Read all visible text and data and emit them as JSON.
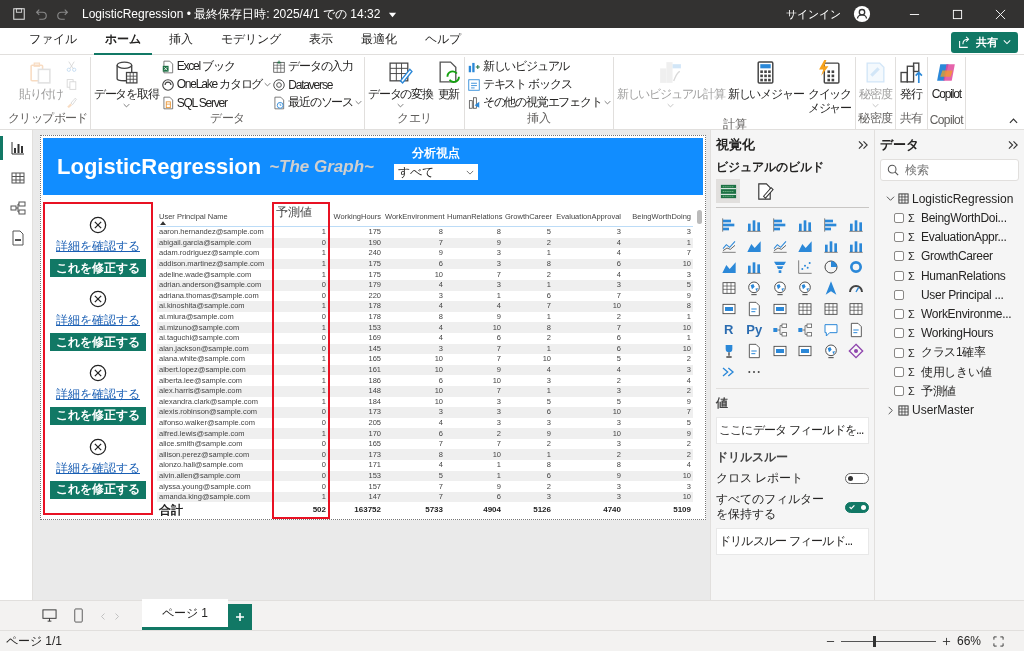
{
  "window": {
    "title": "LogisticRegression • 最終保存日時: 2025/4/1 での 14:32",
    "sign_in": "サインイン"
  },
  "menu_tabs": [
    {
      "label": "ファイル",
      "selected": false
    },
    {
      "label": "ホーム",
      "selected": true
    },
    {
      "label": "挿入",
      "selected": false
    },
    {
      "label": "モデリング",
      "selected": false
    },
    {
      "label": "表示",
      "selected": false
    },
    {
      "label": "最適化",
      "selected": false
    },
    {
      "label": "ヘルプ",
      "selected": false
    }
  ],
  "share_button": "共有",
  "ribbon": [
    {
      "label": "クリップボード",
      "columns": [
        [
          {
            "kind": "large",
            "label": "貼り付け",
            "disabled": true,
            "has_menu": false
          }
        ],
        [
          {
            "kind": "icon",
            "disabled": true
          },
          {
            "kind": "icon",
            "disabled": true
          },
          {
            "kind": "icon",
            "disabled": true
          }
        ]
      ]
    },
    {
      "label": "データ",
      "columns": [
        [
          {
            "kind": "large",
            "label": "データを取得",
            "disabled": false,
            "has_menu": true
          }
        ],
        [
          {
            "kind": "small",
            "label": "Excel ブック",
            "disabled": false,
            "has_menu": false
          },
          {
            "kind": "small",
            "label": "OneLake カタログ",
            "disabled": false,
            "has_menu": true
          },
          {
            "kind": "small",
            "label": "SQL Server",
            "disabled": false,
            "has_menu": false
          }
        ],
        [
          {
            "kind": "small",
            "label": "データの入力",
            "disabled": false,
            "has_menu": false
          },
          {
            "kind": "small",
            "label": "Dataverse",
            "disabled": false,
            "has_menu": false
          },
          {
            "kind": "small",
            "label": "最近のソース",
            "disabled": false,
            "has_menu": true
          }
        ]
      ]
    },
    {
      "label": "クエリ",
      "columns": [
        [
          {
            "kind": "large",
            "label": "データの変換",
            "disabled": false,
            "has_menu": true
          }
        ],
        [
          {
            "kind": "large",
            "label": "更新",
            "disabled": false,
            "has_menu": false
          }
        ]
      ]
    },
    {
      "label": "挿入",
      "columns": [
        [
          {
            "kind": "small",
            "label": "新しいビジュアル",
            "disabled": false,
            "has_menu": false
          },
          {
            "kind": "small",
            "label": "テキスト ボックス",
            "disabled": false,
            "has_menu": false
          },
          {
            "kind": "small",
            "label": "その他の視覚エフェクト",
            "disabled": false,
            "has_menu": true
          }
        ]
      ]
    },
    {
      "label": "計算",
      "columns": [
        [
          {
            "kind": "large",
            "label": "新しいビジュアル計算",
            "disabled": true,
            "has_menu": true
          }
        ],
        [
          {
            "kind": "large",
            "label": "新しいメジャー",
            "disabled": false,
            "has_menu": false
          }
        ],
        [
          {
            "kind": "large",
            "label": "クイックメジャー",
            "disabled": false,
            "has_menu": false
          }
        ]
      ]
    },
    {
      "label": "秘密度",
      "columns": [
        [
          {
            "kind": "large",
            "label": "秘密度",
            "disabled": true,
            "has_menu": true
          }
        ]
      ]
    },
    {
      "label": "共有",
      "columns": [
        [
          {
            "kind": "large",
            "label": "発行",
            "disabled": false,
            "has_menu": false
          }
        ]
      ]
    },
    {
      "label": "Copilot",
      "columns": [
        [
          {
            "kind": "large",
            "label": "Copilot",
            "disabled": false,
            "has_menu": false
          }
        ]
      ]
    }
  ],
  "views": [
    {
      "selected": true
    },
    {
      "selected": false
    },
    {
      "selected": false
    },
    {
      "selected": false
    }
  ],
  "report": {
    "title": "LogisticRegression",
    "subtitle": "~The Graph~",
    "slicer": {
      "label": "分析視点",
      "value": "すべて"
    },
    "cards_highlighted": true,
    "cards": [
      {
        "link": "詳細を確認する",
        "button": "これを修正する"
      },
      {
        "link": "詳細を確認する",
        "button": "これを修正する"
      },
      {
        "link": "詳細を確認する",
        "button": "これを修正する"
      },
      {
        "link": "詳細を確認する",
        "button": "これを修正する"
      }
    ],
    "table": {
      "columns": [
        {
          "label": "User Principal Name",
          "sorted": true,
          "highlighted": false
        },
        {
          "label": "予測値",
          "sorted": false,
          "highlighted": true
        },
        {
          "label": "WorkingHours",
          "sorted": false,
          "highlighted": false
        },
        {
          "label": "WorkEnvironment",
          "sorted": false,
          "highlighted": false
        },
        {
          "label": "HumanRelations",
          "sorted": false,
          "highlighted": false
        },
        {
          "label": "GrowthCareer",
          "sorted": false,
          "highlighted": false
        },
        {
          "label": "EvaluationApproval",
          "sorted": false,
          "highlighted": false
        },
        {
          "label": "BeingWorthDoing",
          "sorted": false,
          "highlighted": false
        }
      ],
      "rows": [
        [
          "aaron.hernandez@sample.com",
          "1",
          "175",
          "8",
          "8",
          "5",
          "3",
          "3"
        ],
        [
          "abigail.garcia@sample.com",
          "0",
          "190",
          "7",
          "9",
          "2",
          "4",
          "1"
        ],
        [
          "adam.rodriguez@sample.com",
          "1",
          "240",
          "9",
          "3",
          "1",
          "4",
          "7"
        ],
        [
          "addison.martinez@sample.com",
          "1",
          "175",
          "6",
          "3",
          "8",
          "6",
          "10"
        ],
        [
          "adeline.wade@sample.com",
          "1",
          "175",
          "10",
          "7",
          "2",
          "4",
          "3"
        ],
        [
          "adrian.anderson@sample.com",
          "0",
          "179",
          "4",
          "3",
          "1",
          "3",
          "5"
        ],
        [
          "adriana.thomas@sample.com",
          "0",
          "220",
          "3",
          "1",
          "6",
          "7",
          "9"
        ],
        [
          "ai.kinoshita@sample.com",
          "1",
          "178",
          "4",
          "4",
          "7",
          "10",
          "8"
        ],
        [
          "ai.miura@sample.com",
          "0",
          "178",
          "8",
          "9",
          "1",
          "2",
          "1"
        ],
        [
          "ai.mizuno@sample.com",
          "1",
          "153",
          "4",
          "10",
          "8",
          "7",
          "10"
        ],
        [
          "ai.taguchi@sample.com",
          "0",
          "169",
          "4",
          "6",
          "2",
          "6",
          "1"
        ],
        [
          "alan.jackson@sample.com",
          "0",
          "145",
          "3",
          "7",
          "1",
          "6",
          "10"
        ],
        [
          "alana.white@sample.com",
          "1",
          "165",
          "10",
          "7",
          "10",
          "5",
          "2"
        ],
        [
          "albert.lopez@sample.com",
          "1",
          "161",
          "10",
          "9",
          "4",
          "4",
          "3"
        ],
        [
          "alberta.lee@sample.com",
          "1",
          "186",
          "6",
          "10",
          "3",
          "2",
          "4"
        ],
        [
          "alex.harris@sample.com",
          "1",
          "148",
          "10",
          "7",
          "1",
          "3",
          "2"
        ],
        [
          "alexandra.clark@sample.com",
          "1",
          "184",
          "10",
          "3",
          "5",
          "5",
          "9"
        ],
        [
          "alexis.robinson@sample.com",
          "0",
          "173",
          "3",
          "3",
          "6",
          "10",
          "7"
        ],
        [
          "alfonso.walker@sample.com",
          "0",
          "205",
          "4",
          "3",
          "3",
          "3",
          "5"
        ],
        [
          "alfred.lewis@sample.com",
          "1",
          "170",
          "6",
          "2",
          "9",
          "10",
          "9"
        ],
        [
          "alice.smith@sample.com",
          "0",
          "165",
          "7",
          "7",
          "2",
          "3",
          "2"
        ],
        [
          "allison.perez@sample.com",
          "0",
          "173",
          "8",
          "10",
          "1",
          "2",
          "2"
        ],
        [
          "alonzo.hall@sample.com",
          "0",
          "171",
          "4",
          "1",
          "8",
          "8",
          "4"
        ],
        [
          "alvin.allen@sample.com",
          "0",
          "153",
          "5",
          "1",
          "6",
          "9",
          "10"
        ],
        [
          "alyssa.young@sample.com",
          "0",
          "157",
          "7",
          "9",
          "2",
          "3",
          "3"
        ],
        [
          "amanda.king@sample.com",
          "1",
          "147",
          "7",
          "6",
          "3",
          "3",
          "10"
        ]
      ],
      "total": [
        "合計",
        "502",
        "163752",
        "5733",
        "4904",
        "5126",
        "4740",
        "5109"
      ]
    }
  },
  "visualizations": {
    "title": "視覚化",
    "subtitle": "ビジュアルのビルド",
    "build_tabs": [
      {
        "selected": true
      },
      {
        "selected": false
      }
    ],
    "script_visuals": [
      "R",
      "Py"
    ],
    "values_label": "値",
    "values_well": "ここにデータ フィールドを...",
    "drillthrough_title": "ドリルスルー",
    "toggles": [
      {
        "label": "クロス レポート",
        "on": false
      },
      {
        "label": "すべてのフィルターを保持する",
        "on": true
      }
    ],
    "drillthrough_well": "ドリルスルー フィールド..."
  },
  "data_pane": {
    "title": "データ",
    "search_placeholder": "検索",
    "tables": [
      {
        "name": "LogisticRegression",
        "expanded": true,
        "fields": [
          {
            "name": "BeingWorthDoi...",
            "symbol": "Σ",
            "checked": false
          },
          {
            "name": "EvaluationAppr...",
            "symbol": "Σ",
            "checked": false
          },
          {
            "name": "GrowthCareer",
            "symbol": "Σ",
            "checked": false
          },
          {
            "name": "HumanRelations",
            "symbol": "Σ",
            "checked": false
          },
          {
            "name": "User Principal ...",
            "checked": false
          },
          {
            "name": "WorkEnvironme...",
            "symbol": "Σ",
            "checked": false
          },
          {
            "name": "WorkingHours",
            "symbol": "Σ",
            "checked": false
          },
          {
            "name": "クラス1確率",
            "symbol": "Σ",
            "checked": false
          },
          {
            "name": "使用しきい値",
            "symbol": "Σ",
            "checked": false
          },
          {
            "name": "予測値",
            "symbol": "Σ",
            "checked": false
          }
        ]
      },
      {
        "name": "UserMaster",
        "expanded": false
      }
    ]
  },
  "pages": [
    {
      "label": "ページ 1",
      "selected": true
    }
  ],
  "status": {
    "page": "ページ 1/1",
    "zoom": "66%"
  },
  "zoom_slider": {
    "level": 0.35
  }
}
